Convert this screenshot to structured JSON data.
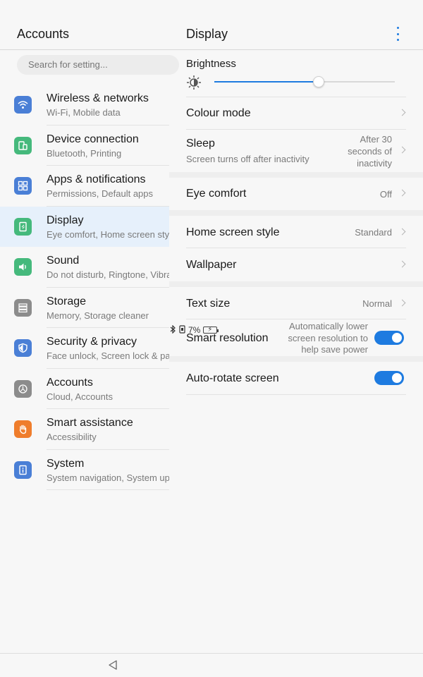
{
  "status": {
    "battery": "7%"
  },
  "left": {
    "title": "Accounts",
    "search_placeholder": "Search for setting...",
    "items": [
      {
        "title": "Wireless & networks",
        "subtitle": "Wi-Fi, Mobile data",
        "icon": "wifi-icon",
        "color": "#4a7fd6"
      },
      {
        "title": "Device connection",
        "subtitle": "Bluetooth, Printing",
        "icon": "device-connection-icon",
        "color": "#45b97c"
      },
      {
        "title": "Apps & notifications",
        "subtitle": "Permissions, Default apps",
        "icon": "apps-icon",
        "color": "#4a7fd6"
      },
      {
        "title": "Display",
        "subtitle": "Eye comfort, Home screen style",
        "icon": "display-icon",
        "color": "#45b97c"
      },
      {
        "title": "Sound",
        "subtitle": "Do not disturb, Ringtone, Vibrate",
        "icon": "sound-icon",
        "color": "#45b97c"
      },
      {
        "title": "Storage",
        "subtitle": "Memory, Storage cleaner",
        "icon": "storage-icon",
        "color": "#8c8c8c"
      },
      {
        "title": "Security & privacy",
        "subtitle": "Face unlock, Screen lock & passwords",
        "icon": "shield-icon",
        "color": "#4a7fd6"
      },
      {
        "title": "Accounts",
        "subtitle": "Cloud, Accounts",
        "icon": "accounts-icon",
        "color": "#8c8c8c"
      },
      {
        "title": "Smart assistance",
        "subtitle": "Accessibility",
        "icon": "hand-icon",
        "color": "#ef7d2c"
      },
      {
        "title": "System",
        "subtitle": "System navigation, System update",
        "icon": "system-icon",
        "color": "#4a7fd6"
      }
    ]
  },
  "right": {
    "title": "Display",
    "brightness_label": "Brightness",
    "brightness_level": 0.58,
    "colour_mode": "Colour mode",
    "sleep": {
      "label": "Sleep",
      "subtitle": "Screen turns off after inactivity",
      "value_line1": "After 30",
      "value_line2": "seconds of",
      "value_line3": "inactivity"
    },
    "eye_comfort": {
      "label": "Eye comfort",
      "value": "Off"
    },
    "home_screen_style": {
      "label": "Home screen style",
      "value": "Standard"
    },
    "wallpaper": {
      "label": "Wallpaper"
    },
    "text_size": {
      "label": "Text size",
      "value": "Normal"
    },
    "smart_resolution": {
      "label": "Smart resolution",
      "desc_line1": "Automatically lower",
      "desc_line2": "screen resolution to",
      "desc_line3": "help save power",
      "enabled": true
    },
    "auto_rotate": {
      "label": "Auto-rotate screen",
      "enabled": true
    }
  },
  "accent": "#1e7be0"
}
